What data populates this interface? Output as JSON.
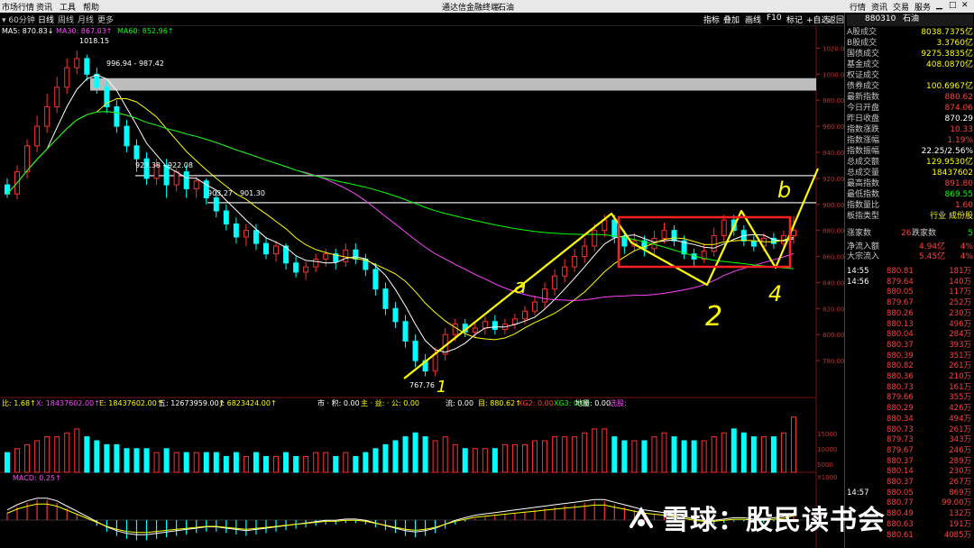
{
  "menu": [
    "市场行情",
    "资讯",
    "工具",
    "帮助"
  ],
  "window_title": "通达信金融终端",
  "window_subtitle": "石油",
  "menu_right": [
    "行情",
    "资讯",
    "交易",
    "服务"
  ],
  "period": "60分钟",
  "tabs": [
    "日线",
    "周线",
    "月线",
    "更多"
  ],
  "toolbar": [
    "指标",
    "叠加",
    "画线",
    "F10",
    "标记",
    "+自选",
    "返回"
  ],
  "panel": {
    "code": "880310",
    "name": "石油",
    "stats": [
      {
        "label": "A股成交",
        "value": "8038.7375亿",
        "color": "#ffff00"
      },
      {
        "label": "B股成交",
        "value": "3.3760亿",
        "color": "#ffff00"
      },
      {
        "label": "国债成交",
        "value": "9275.3835亿",
        "color": "#ffff00"
      },
      {
        "label": "基金成交",
        "value": "408.0870亿",
        "color": "#ffff00"
      },
      {
        "label": "权证成交",
        "value": "",
        "color": "#ffff00"
      },
      {
        "label": "债券成交",
        "value": "100.6967亿",
        "color": "#ffff00"
      },
      {
        "label": "最新指数",
        "value": "880.62",
        "color": "#ff4040"
      },
      {
        "label": "今日开盘",
        "value": "874.06",
        "color": "#ff4040"
      },
      {
        "label": "昨日收盘",
        "value": "870.29",
        "color": "#ffffff"
      },
      {
        "label": "指数涨跌",
        "value": "10.33",
        "color": "#ff4040"
      },
      {
        "label": "指数涨幅",
        "value": "1.19%",
        "color": "#ff4040"
      },
      {
        "label": "指数振幅",
        "value": "22.25/2.56%",
        "color": "#ffffff"
      },
      {
        "label": "总成交额",
        "value": "129.9530亿",
        "color": "#ffff00"
      },
      {
        "label": "总成交量",
        "value": "18437602",
        "color": "#ffff00"
      },
      {
        "label": "最高指数",
        "value": "891.80",
        "color": "#ff4040"
      },
      {
        "label": "最低指数",
        "value": "869.55",
        "color": "#00ff00"
      },
      {
        "label": "指数量比",
        "value": "1.60",
        "color": "#ff4040"
      },
      {
        "label": "板指类型",
        "value": "行业 成份股",
        "color": "#ffff00"
      }
    ],
    "up_label": "涨家数",
    "up_value": "26",
    "down_label": "跌家数",
    "down_value": "5",
    "inflow": [
      {
        "label": "净流入额",
        "value": "4.94亿",
        "pct": "4%"
      },
      {
        "label": "大宗流入",
        "value": "5.45亿",
        "pct": "4%"
      }
    ],
    "ticks": [
      {
        "t": "14:55",
        "p": "880.81",
        "q": "181万"
      },
      {
        "t": "14:56",
        "p": "879.64",
        "q": "140万"
      },
      {
        "t": "",
        "p": "880.05",
        "q": "117万"
      },
      {
        "t": "",
        "p": "879.67",
        "q": "252万"
      },
      {
        "t": "",
        "p": "880.26",
        "q": "230万"
      },
      {
        "t": "",
        "p": "880.13",
        "q": "496万"
      },
      {
        "t": "",
        "p": "880.04",
        "q": "284万"
      },
      {
        "t": "",
        "p": "880.37",
        "q": "393万"
      },
      {
        "t": "",
        "p": "880.39",
        "q": "351万"
      },
      {
        "t": "",
        "p": "880.82",
        "q": "261万"
      },
      {
        "t": "",
        "p": "880.36",
        "q": "210万"
      },
      {
        "t": "",
        "p": "880.73",
        "q": "161万"
      },
      {
        "t": "",
        "p": "879.66",
        "q": "355万"
      },
      {
        "t": "",
        "p": "880.29",
        "q": "426万"
      },
      {
        "t": "",
        "p": "880.34",
        "q": "494万"
      },
      {
        "t": "",
        "p": "880.73",
        "q": "261万"
      },
      {
        "t": "",
        "p": "879.73",
        "q": "343万"
      },
      {
        "t": "",
        "p": "879.67",
        "q": "246万"
      },
      {
        "t": "",
        "p": "880.37",
        "q": "289万"
      },
      {
        "t": "",
        "p": "880.14",
        "q": "230万"
      },
      {
        "t": "",
        "p": "880.37",
        "q": "267万"
      },
      {
        "t": "14:57",
        "p": "880.05",
        "q": "869万"
      },
      {
        "t": "",
        "p": "880.77",
        "q": "99.00万"
      },
      {
        "t": "",
        "p": "880.49",
        "q": "132万"
      },
      {
        "t": "",
        "p": "880.63",
        "q": "191万"
      },
      {
        "t": "",
        "p": "880.61",
        "q": "4085万"
      }
    ]
  },
  "legend": [
    {
      "text": "MA5: 870.83↓",
      "color": "#ffffff"
    },
    {
      "text": "MA30: 867.03↑",
      "color": "#ff44ff"
    },
    {
      "text": "MA60: 852.96↑",
      "color": "#00ff00"
    }
  ],
  "vol_legend": [
    {
      "text": "比: 1.68↑",
      "color": "#ffff00"
    },
    {
      "text": "X: 18437602.00↑",
      "color": "#ff44ff"
    },
    {
      "text": "E: 18437602.00↑",
      "color": "#ffff00"
    },
    {
      "text": "五: 12673959.00↑",
      "color": "#ffffff"
    },
    {
      "text": "J: 6823424.00↑",
      "color": "#ffff00"
    },
    {
      "text": "市 · 积: 0.00",
      "color": "#ffffff"
    },
    {
      "text": "主 · 益: · 公: 0.00",
      "color": "#ffff00"
    },
    {
      "text": "流: 0.00",
      "color": "#ffffff"
    },
    {
      "text": "目: 880.62↑",
      "color": "#ffff00"
    },
    {
      "text": "XG2: 0.00",
      "color": "#ff4040"
    },
    {
      "text": "XG3: 0.00",
      "color": "#00ff00"
    },
    {
      "text": "地量: 0.00",
      "color": "#ffffff"
    },
    {
      "text": "选股:",
      "color": "#ff44ff"
    }
  ],
  "macd_legend": "MACD: 0.25↑",
  "annotations": {
    "peak": "1018.15",
    "band1": "996.94 - 987.42",
    "band2": "923.38 - 922.08",
    "band3": "903.27 - 901.30",
    "low": "767.76",
    "hand_a": "a",
    "hand_b": "b",
    "hand_1": "1",
    "hand_2": "2",
    "hand_4": "4"
  },
  "watermark": "雪球：股民读书会",
  "chart_data": {
    "type": "candlestick",
    "ylim": [
      760,
      1030
    ],
    "yticks": [
      780,
      800,
      820,
      840,
      860,
      880,
      900,
      920,
      940,
      960,
      980,
      1000,
      1020
    ],
    "vol_ticks": [
      "15000",
      "10000",
      "5000",
      "X1000"
    ],
    "candles": [
      [
        915,
        908,
        920,
        905
      ],
      [
        908,
        925,
        930,
        904
      ],
      [
        925,
        945,
        950,
        920
      ],
      [
        945,
        960,
        968,
        940
      ],
      [
        960,
        975,
        985,
        955
      ],
      [
        975,
        990,
        998,
        970
      ],
      [
        990,
        1005,
        1012,
        985
      ],
      [
        1005,
        1012,
        1018,
        1000
      ],
      [
        1012,
        1000,
        1015,
        995
      ],
      [
        1000,
        990,
        1005,
        985
      ],
      [
        990,
        975,
        995,
        970
      ],
      [
        975,
        960,
        980,
        955
      ],
      [
        960,
        945,
        965,
        940
      ],
      [
        945,
        935,
        950,
        925
      ],
      [
        935,
        920,
        940,
        915
      ],
      [
        920,
        930,
        935,
        915
      ],
      [
        930,
        915,
        935,
        905
      ],
      [
        915,
        925,
        928,
        910
      ],
      [
        925,
        912,
        930,
        905
      ],
      [
        912,
        918,
        922,
        905
      ],
      [
        918,
        905,
        920,
        900
      ],
      [
        905,
        895,
        910,
        890
      ],
      [
        895,
        885,
        900,
        880
      ],
      [
        885,
        875,
        890,
        870
      ],
      [
        875,
        880,
        885,
        868
      ],
      [
        880,
        870,
        885,
        865
      ],
      [
        870,
        862,
        875,
        858
      ],
      [
        862,
        868,
        872,
        856
      ],
      [
        868,
        855,
        870,
        850
      ],
      [
        855,
        848,
        860,
        844
      ],
      [
        848,
        852,
        856,
        842
      ],
      [
        852,
        858,
        862,
        848
      ],
      [
        858,
        862,
        866,
        852
      ],
      [
        862,
        856,
        866,
        850
      ],
      [
        856,
        865,
        870,
        852
      ],
      [
        865,
        858,
        870,
        854
      ],
      [
        858,
        850,
        862,
        845
      ],
      [
        850,
        835,
        855,
        830
      ],
      [
        835,
        820,
        840,
        815
      ],
      [
        820,
        810,
        825,
        805
      ],
      [
        810,
        795,
        815,
        790
      ],
      [
        795,
        780,
        800,
        775
      ],
      [
        780,
        772,
        785,
        768
      ],
      [
        772,
        785,
        790,
        768
      ],
      [
        785,
        800,
        805,
        780
      ],
      [
        800,
        808,
        812,
        795
      ],
      [
        808,
        802,
        812,
        798
      ],
      [
        802,
        805,
        810,
        798
      ],
      [
        805,
        810,
        814,
        800
      ],
      [
        810,
        804,
        815,
        800
      ],
      [
        804,
        808,
        812,
        800
      ],
      [
        808,
        812,
        816,
        804
      ],
      [
        812,
        818,
        822,
        808
      ],
      [
        818,
        825,
        830,
        815
      ],
      [
        825,
        835,
        840,
        820
      ],
      [
        835,
        845,
        850,
        830
      ],
      [
        845,
        852,
        858,
        840
      ],
      [
        852,
        860,
        866,
        848
      ],
      [
        860,
        868,
        874,
        855
      ],
      [
        868,
        880,
        885,
        864
      ],
      [
        880,
        888,
        892,
        875
      ],
      [
        888,
        875,
        892,
        870
      ],
      [
        875,
        868,
        880,
        862
      ],
      [
        868,
        872,
        878,
        864
      ],
      [
        872,
        866,
        876,
        860
      ],
      [
        866,
        874,
        880,
        862
      ],
      [
        874,
        880,
        886,
        870
      ],
      [
        880,
        872,
        884,
        868
      ],
      [
        872,
        862,
        876,
        858
      ],
      [
        862,
        858,
        866,
        852
      ],
      [
        858,
        864,
        870,
        855
      ],
      [
        864,
        876,
        882,
        860
      ],
      [
        876,
        888,
        892,
        872
      ],
      [
        888,
        880,
        892,
        876
      ],
      [
        880,
        872,
        884,
        868
      ],
      [
        872,
        868,
        876,
        864
      ],
      [
        868,
        874,
        878,
        864
      ],
      [
        874,
        870,
        878,
        866
      ],
      [
        870,
        876,
        880,
        866
      ],
      [
        876,
        880,
        891,
        870
      ]
    ],
    "volumes": [
      5,
      6,
      7,
      8,
      9,
      9,
      10,
      11,
      9,
      8,
      7,
      7,
      6,
      6,
      6,
      5,
      6,
      5,
      5,
      5,
      5,
      5,
      4,
      5,
      4,
      5,
      4,
      4,
      5,
      4,
      4,
      5,
      5,
      4,
      5,
      4,
      5,
      6,
      7,
      8,
      9,
      10,
      9,
      8,
      9,
      7,
      6,
      6,
      6,
      6,
      7,
      7,
      7,
      8,
      8,
      9,
      9,
      9,
      10,
      11,
      11,
      9,
      8,
      8,
      8,
      9,
      10,
      9,
      8,
      8,
      8,
      9,
      10,
      11,
      10,
      9,
      9,
      9,
      10,
      14
    ],
    "macd": [
      0.5,
      0.9,
      1.2,
      1.4,
      1.4,
      1.2,
      0.8,
      0.4,
      0.0,
      -0.4,
      -0.8,
      -1.1,
      -1.3,
      -1.4,
      -1.4,
      -1.3,
      -1.2,
      -1.1,
      -1.0,
      -0.9,
      -0.8,
      -0.8,
      -0.9,
      -1.0,
      -1.1,
      -1.0,
      -0.9,
      -0.8,
      -0.7,
      -0.6,
      -0.5,
      -0.4,
      -0.3,
      -0.3,
      -0.2,
      -0.2,
      -0.3,
      -0.5,
      -0.7,
      -0.9,
      -1.1,
      -1.2,
      -1.1,
      -0.9,
      -0.6,
      -0.3,
      -0.1,
      0.1,
      0.2,
      0.3,
      0.4,
      0.5,
      0.6,
      0.7,
      0.8,
      0.9,
      1.0,
      1.1,
      1.2,
      1.3,
      1.3,
      1.1,
      0.9,
      0.7,
      0.5,
      0.4,
      0.3,
      0.2,
      0.0,
      -0.2,
      -0.3,
      -0.3,
      -0.2,
      -0.1,
      -0.1,
      -0.2,
      -0.2,
      -0.1,
      0.0,
      0.25
    ]
  }
}
